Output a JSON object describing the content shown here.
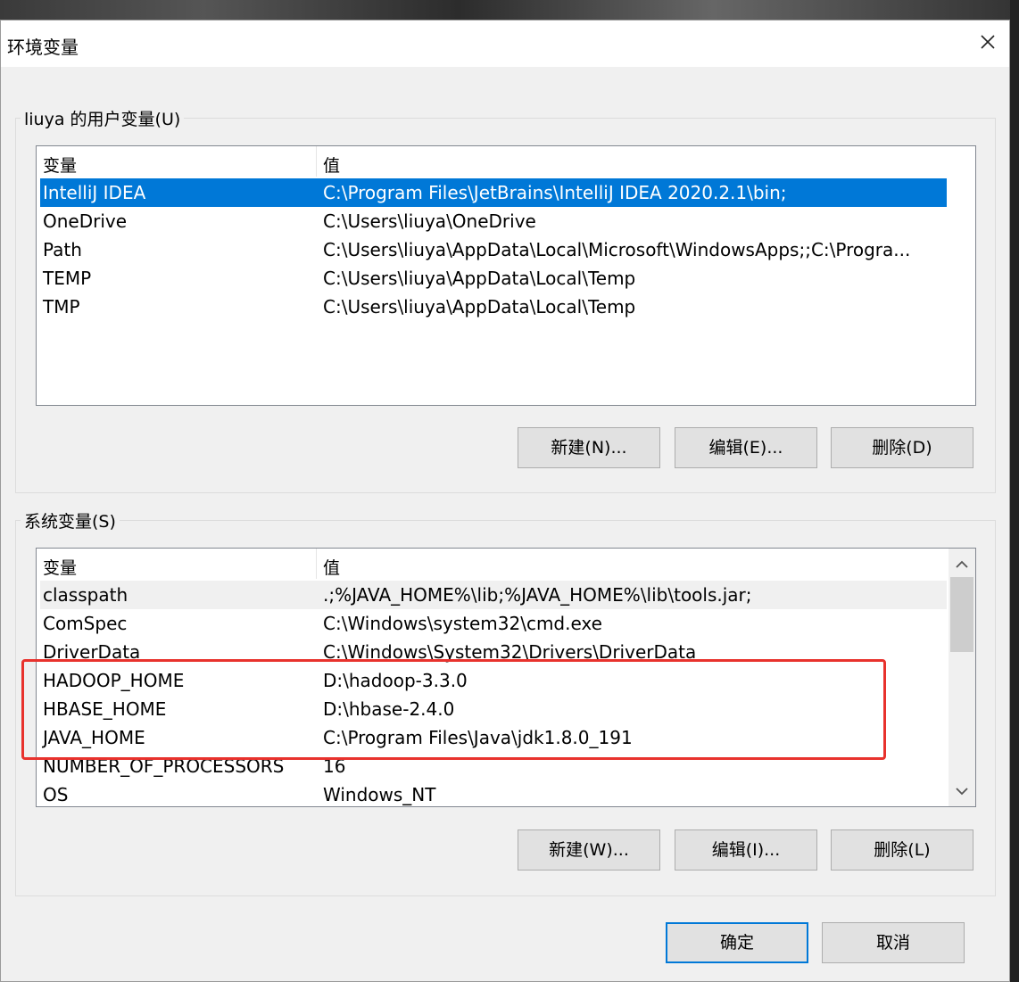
{
  "window": {
    "title": "环境变量"
  },
  "user_vars": {
    "group_label": "liuya 的用户变量(U)",
    "col_variable": "变量",
    "col_value": "值",
    "rows": [
      {
        "name": "IntelliJ IDEA",
        "value": "C:\\Program Files\\JetBrains\\IntelliJ IDEA 2020.2.1\\bin;"
      },
      {
        "name": "OneDrive",
        "value": "C:\\Users\\liuya\\OneDrive"
      },
      {
        "name": "Path",
        "value": "C:\\Users\\liuya\\AppData\\Local\\Microsoft\\WindowsApps;;C:\\Progra..."
      },
      {
        "name": "TEMP",
        "value": "C:\\Users\\liuya\\AppData\\Local\\Temp"
      },
      {
        "name": "TMP",
        "value": "C:\\Users\\liuya\\AppData\\Local\\Temp"
      }
    ],
    "buttons": {
      "new": "新建(N)...",
      "edit": "编辑(E)...",
      "delete": "删除(D)"
    }
  },
  "system_vars": {
    "group_label": "系统变量(S)",
    "col_variable": "变量",
    "col_value": "值",
    "rows": [
      {
        "name": "classpath",
        "value": ".;%JAVA_HOME%\\lib;%JAVA_HOME%\\lib\\tools.jar;"
      },
      {
        "name": "ComSpec",
        "value": "C:\\Windows\\system32\\cmd.exe"
      },
      {
        "name": "DriverData",
        "value": "C:\\Windows\\System32\\Drivers\\DriverData"
      },
      {
        "name": "HADOOP_HOME",
        "value": "D:\\hadoop-3.3.0"
      },
      {
        "name": "HBASE_HOME",
        "value": "D:\\hbase-2.4.0"
      },
      {
        "name": "JAVA_HOME",
        "value": "C:\\Program Files\\Java\\jdk1.8.0_191"
      },
      {
        "name": "NUMBER_OF_PROCESSORS",
        "value": "16"
      },
      {
        "name": "OS",
        "value": "Windows_NT"
      }
    ],
    "buttons": {
      "new": "新建(W)...",
      "edit": "编辑(I)...",
      "delete": "删除(L)"
    }
  },
  "footer": {
    "ok": "确定",
    "cancel": "取消"
  },
  "colors": {
    "selection": "#0078d7",
    "highlight_box": "#e8322d"
  }
}
